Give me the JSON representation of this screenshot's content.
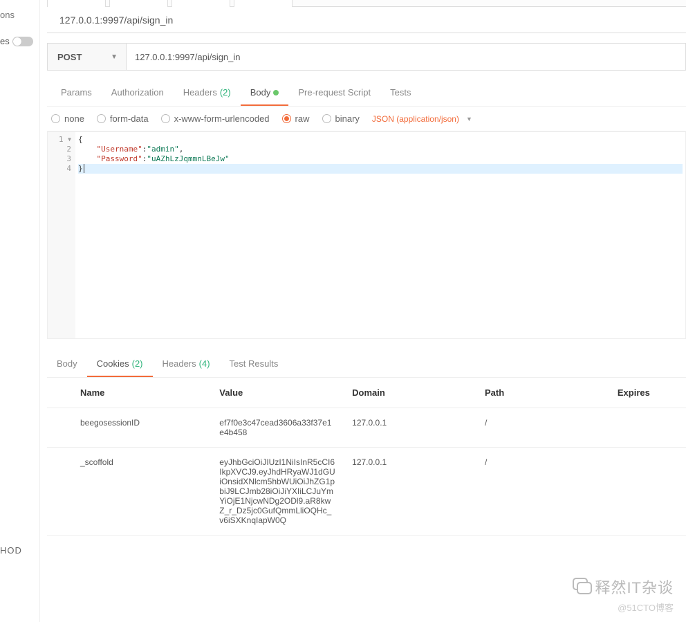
{
  "left_rail": {
    "ons": "ons",
    "es": "es",
    "hod": "HOD"
  },
  "breadcrumb": "127.0.0.1:9997/api/sign_in",
  "method": "POST",
  "url": "127.0.0.1:9997/api/sign_in",
  "tabs": {
    "params": "Params",
    "auth": "Authorization",
    "headers": "Headers",
    "headers_count": "(2)",
    "body": "Body",
    "prereq": "Pre-request Script",
    "tests": "Tests"
  },
  "body_types": {
    "none": "none",
    "form_data": "form-data",
    "xurl": "x-www-form-urlencoded",
    "raw": "raw",
    "binary": "binary",
    "json_dd": "JSON (application/json)"
  },
  "editor": {
    "lines": [
      "1",
      "2",
      "3",
      "4"
    ],
    "l1": "{",
    "l2_key": "\"Username\"",
    "l2_sep": ":",
    "l2_val": "\"admin\"",
    "l2_comma": ",",
    "l3_key": "\"Password\"",
    "l3_sep": ":",
    "l3_val": "\"uAZhLzJqmmnLBeJw\"",
    "l4": "}"
  },
  "resp_tabs": {
    "body": "Body",
    "cookies": "Cookies",
    "cookies_count": "(2)",
    "headers": "Headers",
    "headers_count": "(4)",
    "test_results": "Test Results"
  },
  "cookies": {
    "cols": {
      "name": "Name",
      "value": "Value",
      "domain": "Domain",
      "path": "Path",
      "expires": "Expires"
    },
    "rows": [
      {
        "name": "beegosessionID",
        "value": "ef7f0e3c47cead3606a33f37e1e4b458",
        "domain": "127.0.0.1",
        "path": "/",
        "expires": ""
      },
      {
        "name": "_scoffold",
        "value": "eyJhbGciOiJIUzI1NiIsInR5cCI6IkpXVCJ9.eyJhdHRyaWJ1dGUiOnsidXNlcm5hbWUiOiJhZG1pbiJ9LCJmb28iOiJiYXIiLCJuYmYiOjE1NjcwNDg2ODl9.aR8kwZ_r_Dz5jc0GufQmmLliOQHc_v6iSXKnqIapW0Q",
        "domain": "127.0.0.1",
        "path": "/",
        "expires": ""
      }
    ]
  },
  "watermark": {
    "brand": "释然IT杂谈",
    "sub": "@51CTO博客"
  }
}
